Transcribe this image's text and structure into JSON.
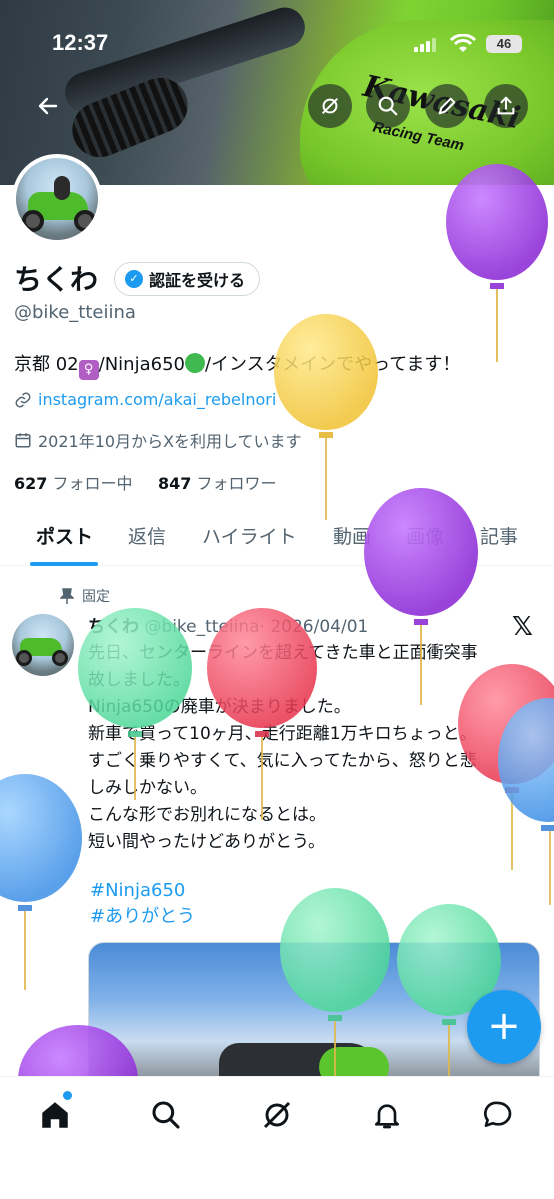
{
  "status_bar": {
    "time": "12:37",
    "battery": "46"
  },
  "profile": {
    "name": "ちくわ",
    "verify_button": "認証を受ける",
    "handle": "@bike_tteiina",
    "bio_prefix": "京都 02",
    "bio_mid": "/Ninja650",
    "bio_suffix": "/インスタメインでやってます！",
    "link": "instagram.com/akai_rebelnori",
    "joined": "2021年10月からXを利用しています",
    "following_count": "627",
    "following_label": "フォロー中",
    "followers_count": "847",
    "followers_label": "フォロワー"
  },
  "tabs": [
    "ポスト",
    "返信",
    "ハイライト",
    "動画",
    "画像",
    "記事"
  ],
  "post": {
    "pinned_label": "固定",
    "author": "ちくわ",
    "handle": "@bike_tteiina",
    "date": "· 2026/04/01",
    "lines": [
      "先日、センターラインを超えてきた車と正面衝突事",
      "故しました。",
      "Ninja650の廃車が決まりました。",
      "新車で買って10ヶ月、走行距離1万キロちょっと。",
      "すごく乗りやすくて、気に入ってたから、怒りと悲",
      "しみしかない。",
      "こんな形でお別れになるとは。",
      "短い間やったけどありがとう。"
    ],
    "hashtags": [
      "#Ninja650",
      "#ありがとう"
    ]
  },
  "banner": {
    "brand": "Kawasaki",
    "brand_sub": "Racing Team"
  },
  "fab": "+",
  "icons": [
    "back-arrow-icon",
    "grok-icon",
    "search-icon",
    "edit-icon",
    "share-icon",
    "home-icon",
    "search-icon",
    "grok-icon",
    "bell-icon",
    "messages-icon"
  ],
  "colors": {
    "accent": "#1d9bf0",
    "text": "#0f1419",
    "muted": "#536471"
  }
}
